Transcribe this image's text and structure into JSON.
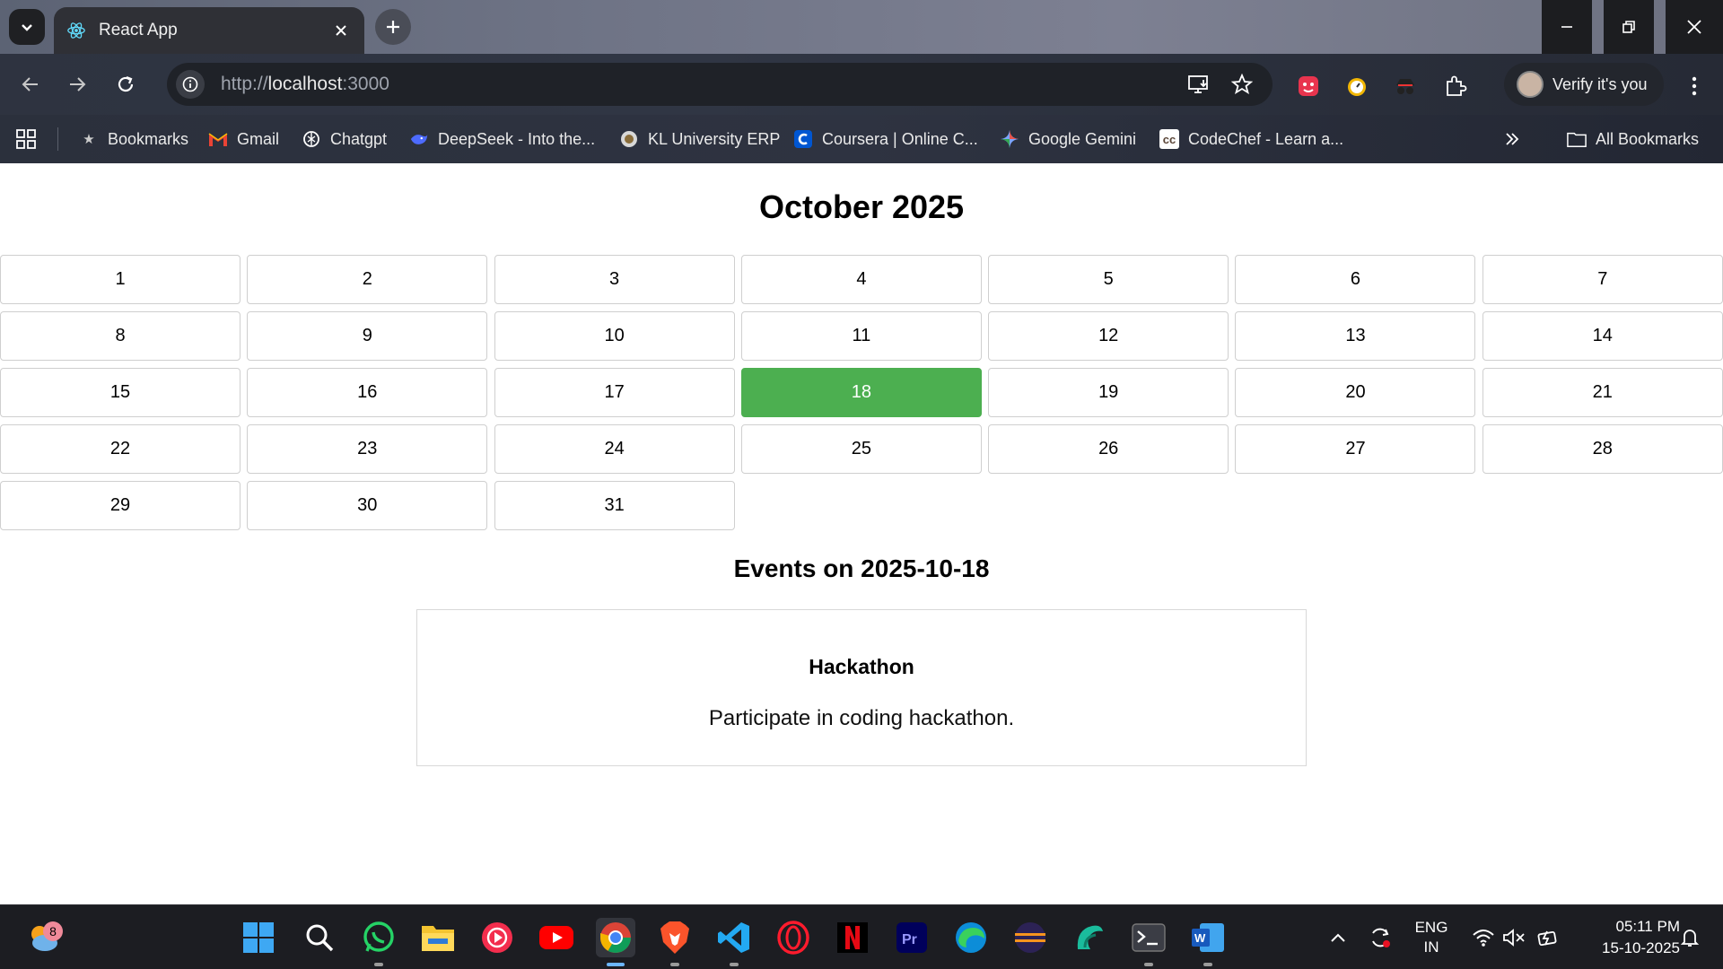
{
  "browser": {
    "tab_title": "React App",
    "url_scheme": "http://",
    "url_host": "localhost",
    "url_port": ":3000",
    "profile_label": "Verify it's you",
    "bookmarks": [
      {
        "label": "Bookmarks",
        "icon": "star-icon"
      },
      {
        "label": "Gmail",
        "icon": "gmail-icon"
      },
      {
        "label": "Chatgpt",
        "icon": "chatgpt-icon"
      },
      {
        "label": "DeepSeek - Into the...",
        "icon": "deepseek-icon"
      },
      {
        "label": "KL University ERP",
        "icon": "kl-university-icon"
      },
      {
        "label": "Coursera | Online C...",
        "icon": "coursera-icon"
      },
      {
        "label": "Google Gemini",
        "icon": "gemini-icon"
      },
      {
        "label": "CodeChef - Learn a...",
        "icon": "codechef-icon"
      }
    ],
    "all_bookmarks_label": "All Bookmarks"
  },
  "calendar": {
    "month_title": "October 2025",
    "days": [
      "1",
      "2",
      "3",
      "4",
      "5",
      "6",
      "7",
      "8",
      "9",
      "10",
      "11",
      "12",
      "13",
      "14",
      "15",
      "16",
      "17",
      "18",
      "19",
      "20",
      "21",
      "22",
      "23",
      "24",
      "25",
      "26",
      "27",
      "28",
      "29",
      "30",
      "31"
    ],
    "selected_day": "18",
    "selected_color": "#4caf50"
  },
  "events": {
    "heading": "Events on 2025-10-18",
    "items": [
      {
        "title": "Hackathon",
        "description": "Participate in coding hackathon."
      }
    ]
  },
  "taskbar": {
    "weather_badge": "8",
    "lang_line1": "ENG",
    "lang_line2": "IN",
    "time": "05:11 PM",
    "date": "15-10-2025",
    "apps": [
      "windows-start-icon",
      "search-icon",
      "whatsapp-icon",
      "file-explorer-icon",
      "music-icon",
      "youtube-icon",
      "chrome-icon",
      "brave-icon",
      "vscode-icon",
      "opera-icon",
      "netflix-icon",
      "premiere-pro-icon",
      "edge-icon",
      "eclipse-icon",
      "app-icon",
      "terminal-icon",
      "word-icon"
    ]
  }
}
